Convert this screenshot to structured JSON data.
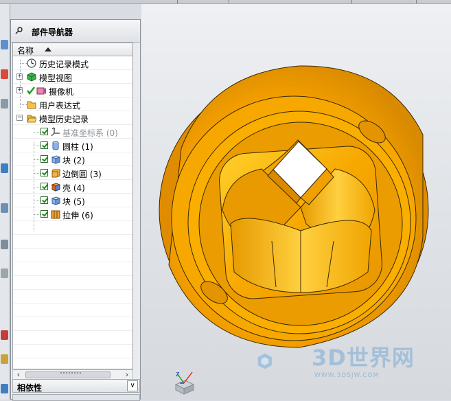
{
  "navigator": {
    "title": "部件导航器",
    "column_name": "名称",
    "items": [
      {
        "label": "历史记录模式",
        "icon": "clock-icon",
        "expander": "",
        "checked": false,
        "dim": false
      },
      {
        "label": "模型视图",
        "icon": "model-view-icon",
        "expander": "+",
        "checked": false,
        "dim": false
      },
      {
        "label": "摄像机",
        "icon": "camera-icon",
        "expander": "+",
        "checked": true,
        "dim": false
      },
      {
        "label": "用户表达式",
        "icon": "folder-icon",
        "expander": "",
        "checked": false,
        "dim": false
      },
      {
        "label": "模型历史记录",
        "icon": "folder-open-icon",
        "expander": "−",
        "checked": false,
        "dim": false
      },
      {
        "label": "基准坐标系 (0)",
        "icon": "datum-csys-icon",
        "expander": "",
        "checked": true,
        "dim": true
      },
      {
        "label": "圆柱 (1)",
        "icon": "cylinder-icon",
        "expander": "",
        "checked": true,
        "dim": false
      },
      {
        "label": "块 (2)",
        "icon": "block-icon",
        "expander": "",
        "checked": true,
        "dim": false
      },
      {
        "label": "边倒圆 (3)",
        "icon": "edge-blend-icon",
        "expander": "",
        "checked": true,
        "dim": false
      },
      {
        "label": "壳 (4)",
        "icon": "shell-icon",
        "expander": "",
        "checked": true,
        "dim": false
      },
      {
        "label": "块 (5)",
        "icon": "block-icon",
        "expander": "",
        "checked": true,
        "dim": false
      },
      {
        "label": "拉伸 (6)",
        "icon": "extrude-icon",
        "expander": "",
        "checked": true,
        "dim": false
      }
    ],
    "dependencies_label": "相依性",
    "scroll_left": "‹",
    "scroll_right": "›",
    "dropdown_glyph": "∨"
  },
  "watermark": {
    "brand": "3D世界网",
    "url": "WWW.3DSJW.COM"
  },
  "colors": {
    "part_face": "#f5a000",
    "part_light": "#ffc21a",
    "part_dark": "#c87800",
    "edge": "#3a2800"
  }
}
